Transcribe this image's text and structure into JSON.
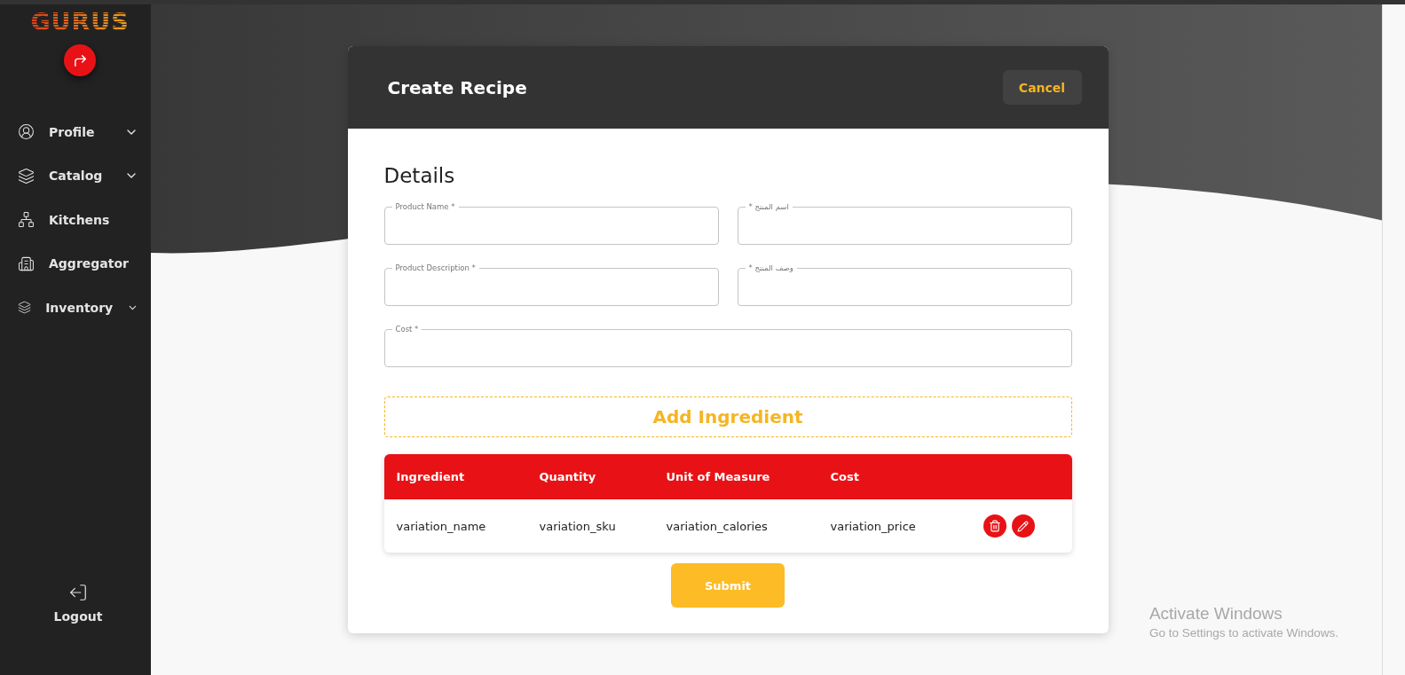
{
  "sidebar": {
    "logo": "GURUS",
    "items": [
      {
        "label": "Profile",
        "expandable": true
      },
      {
        "label": "Catalog",
        "expandable": true
      },
      {
        "label": "Kitchens",
        "expandable": false
      },
      {
        "label": "Aggregator",
        "expandable": false
      },
      {
        "label": "Inventory",
        "expandable": true
      }
    ],
    "logout": "Logout"
  },
  "dialog": {
    "title": "Create Recipe",
    "cancel": "Cancel",
    "section_title": "Details",
    "field_rows": [
      [
        {
          "label": "Product Name *"
        },
        {
          "label": "اسم المنتج *"
        }
      ],
      [
        {
          "label": "Product Description *"
        },
        {
          "label": "وصف المنتج *"
        }
      ],
      [
        {
          "label": "Cost *"
        }
      ]
    ],
    "add_button": "Add Ingredient",
    "table": {
      "columns": [
        "Ingredient",
        "Quantity",
        "Unit of Measure",
        "Cost"
      ],
      "rows": [
        {
          "cells": [
            "variation_name",
            "variation_sku",
            "variation_calories",
            "variation_price"
          ]
        }
      ]
    },
    "submit": "Submit"
  },
  "os_notice": {
    "title": "Activate Windows",
    "subtitle": "Go to Settings to activate Windows."
  }
}
